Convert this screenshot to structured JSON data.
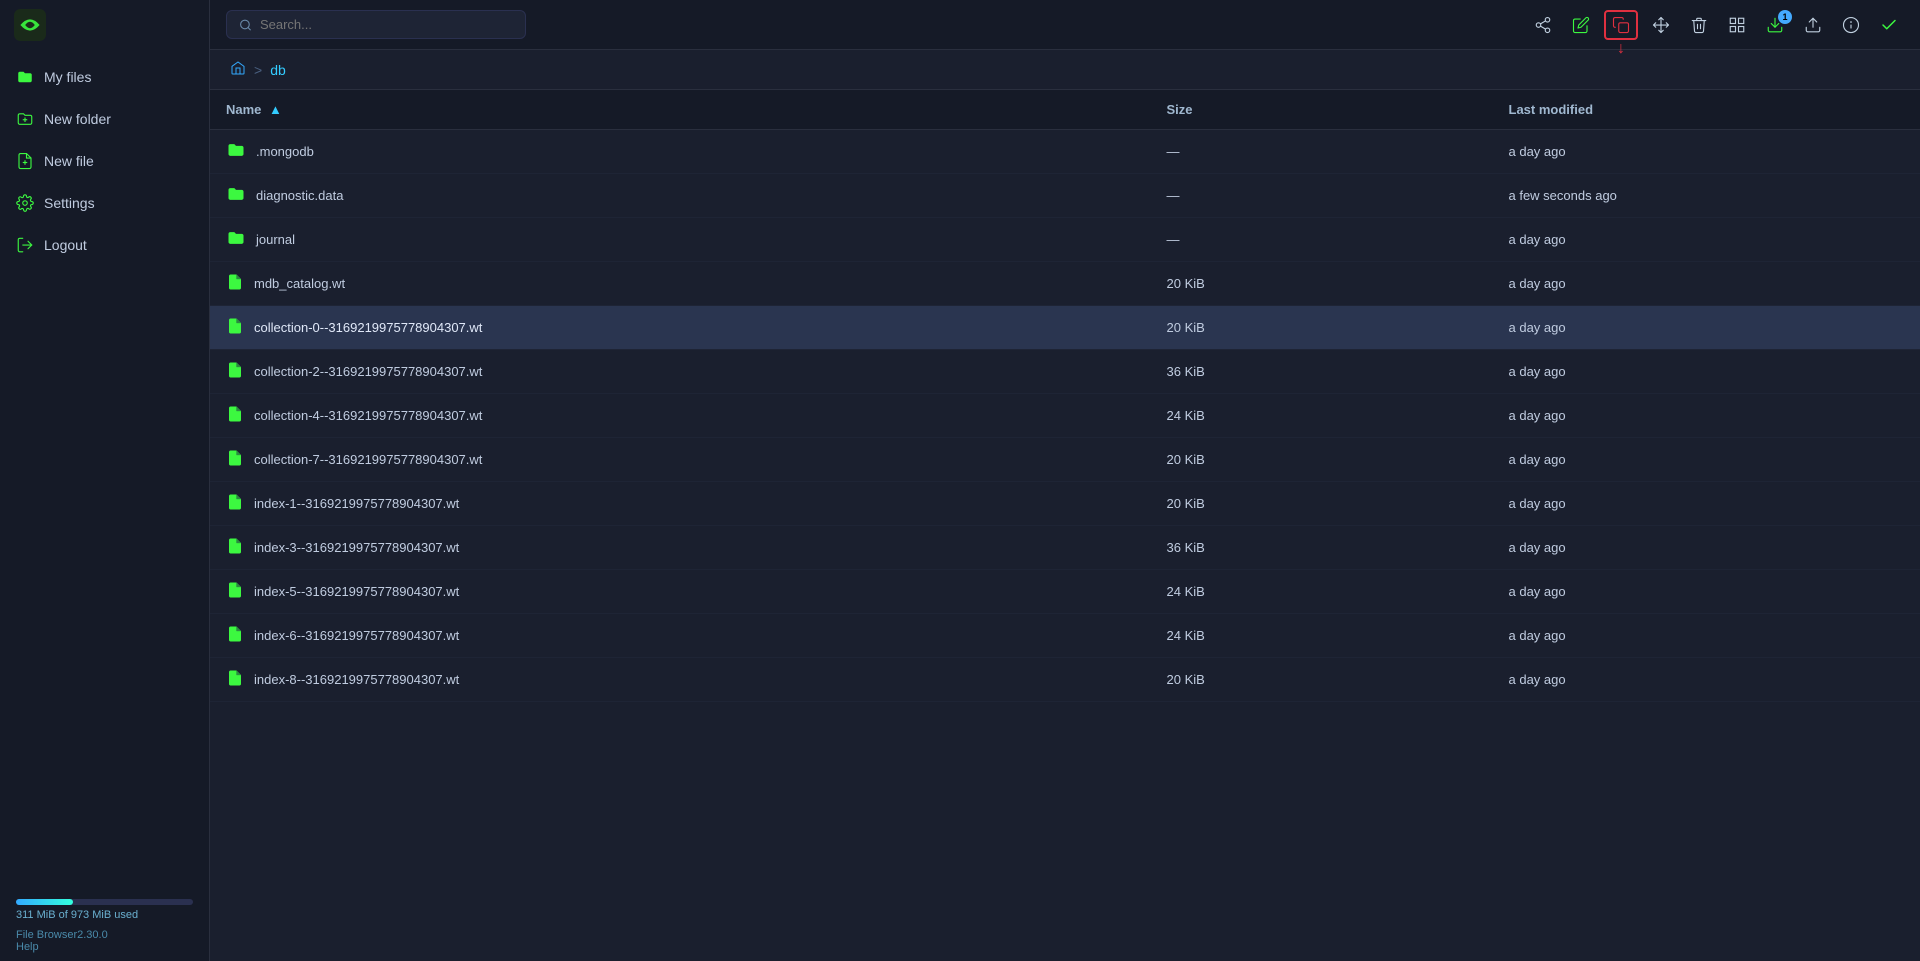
{
  "app": {
    "title": "File Browser"
  },
  "search": {
    "placeholder": "Search..."
  },
  "sidebar": {
    "items": [
      {
        "id": "my-files",
        "label": "My files",
        "icon": "folder-icon"
      },
      {
        "id": "new-folder",
        "label": "New folder",
        "icon": "folder-plus-icon"
      },
      {
        "id": "new-file",
        "label": "New file",
        "icon": "file-plus-icon"
      },
      {
        "id": "settings",
        "label": "Settings",
        "icon": "settings-icon"
      },
      {
        "id": "logout",
        "label": "Logout",
        "icon": "logout-icon"
      }
    ],
    "storage": {
      "label": "311 MiB of 973 MiB used"
    },
    "version": "File Browser2.30.0",
    "help": "Help"
  },
  "breadcrumb": {
    "home_title": "Home",
    "separator": ">",
    "current": "db"
  },
  "table": {
    "columns": {
      "name": "Name",
      "size": "Size",
      "modified": "Last modified"
    },
    "files": [
      {
        "name": ".mongodb",
        "type": "folder",
        "size": "—",
        "modified": "a day ago",
        "selected": false
      },
      {
        "name": "diagnostic.data",
        "type": "folder",
        "size": "—",
        "modified": "a few seconds ago",
        "selected": false
      },
      {
        "name": "journal",
        "type": "folder",
        "size": "—",
        "modified": "a day ago",
        "selected": false
      },
      {
        "name": " mdb_catalog.wt",
        "type": "file",
        "size": "20 KiB",
        "modified": "a day ago",
        "selected": false
      },
      {
        "name": "collection-0--3169219975778904307.wt",
        "type": "file",
        "size": "20 KiB",
        "modified": "a day ago",
        "selected": true
      },
      {
        "name": "collection-2--3169219975778904307.wt",
        "type": "file",
        "size": "36 KiB",
        "modified": "a day ago",
        "selected": false
      },
      {
        "name": "collection-4--3169219975778904307.wt",
        "type": "file",
        "size": "24 KiB",
        "modified": "a day ago",
        "selected": false
      },
      {
        "name": "collection-7--3169219975778904307.wt",
        "type": "file",
        "size": "20 KiB",
        "modified": "a day ago",
        "selected": false
      },
      {
        "name": "index-1--3169219975778904307.wt",
        "type": "file",
        "size": "20 KiB",
        "modified": "a day ago",
        "selected": false
      },
      {
        "name": "index-3--3169219975778904307.wt",
        "type": "file",
        "size": "36 KiB",
        "modified": "a day ago",
        "selected": false
      },
      {
        "name": "index-5--3169219975778904307.wt",
        "type": "file",
        "size": "24 KiB",
        "modified": "a day ago",
        "selected": false
      },
      {
        "name": "index-6--3169219975778904307.wt",
        "type": "file",
        "size": "24 KiB",
        "modified": "a day ago",
        "selected": false
      },
      {
        "name": "index-8--3169219975778904307.wt",
        "type": "file",
        "size": "20 KiB",
        "modified": "a day ago",
        "selected": false
      }
    ]
  },
  "toolbar": {
    "share": "share-icon",
    "edit": "edit-icon",
    "copy": "copy-icon",
    "move": "move-icon",
    "delete": "delete-icon",
    "grid": "grid-icon",
    "download": "download-icon",
    "upload": "upload-icon",
    "info": "info-icon",
    "check": "check-icon",
    "download_badge": "1"
  }
}
